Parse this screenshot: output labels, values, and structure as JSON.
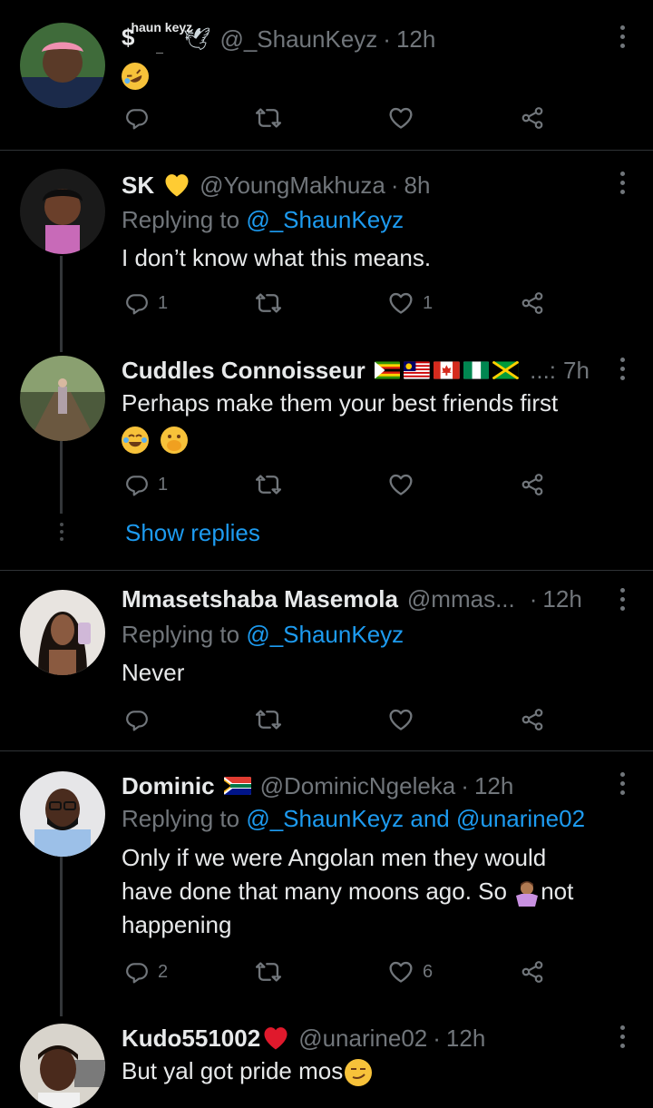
{
  "icons": {
    "reply": "reply-icon",
    "retweet": "retweet-icon",
    "like": "heart-icon",
    "share": "share-icon",
    "more": "more-options-icon"
  },
  "colors": {
    "background": "#000000",
    "text": "#e7e9ea",
    "muted": "#71767b",
    "accent": "#1d9bf0",
    "divider": "#2f3336"
  },
  "tweets": [
    {
      "name": "$",
      "name_sup": "haun keyz",
      "name_sub": "_",
      "handle": "@_ShaunKeyz",
      "time": "12h",
      "body_emoji": "rolling-on-floor-laughing-emoji",
      "reply_count": "",
      "like_count": ""
    },
    {
      "name": "SK",
      "handle": "@YoungMakhuza",
      "time": "8h",
      "replying_prefix": "Replying to",
      "replying_to": "@_ShaunKeyz",
      "body": "I don’t know what this means.",
      "reply_count": "1",
      "like_count": "1"
    },
    {
      "name": "Cuddles Connoisseur",
      "handle": "...:",
      "time": "7h",
      "body": "Perhaps make them your best friends first",
      "reply_count": "1",
      "like_count": "",
      "show_replies": "Show replies"
    },
    {
      "name": "Mmasetshaba Masemola",
      "handle": "@mmas...",
      "time": "12h",
      "replying_prefix": "Replying to",
      "replying_to": "@_ShaunKeyz",
      "body": "Never",
      "reply_count": "",
      "like_count": ""
    },
    {
      "name": "Dominic",
      "handle": "@DominicNgeleka",
      "time": "12h",
      "replying_prefix": "Replying to",
      "replying_to": "@_ShaunKeyz and @unarine02",
      "body_line1": "Only if we were Angolan men they would",
      "body_line2a": "have done that many moons ago. So ",
      "body_line2b": "not",
      "body_line3": "happening",
      "reply_count": "2",
      "like_count": "6"
    },
    {
      "name": "Kudo551002",
      "handle": "@unarine02",
      "time": "12h",
      "body": "But yal got pride mos"
    }
  ]
}
